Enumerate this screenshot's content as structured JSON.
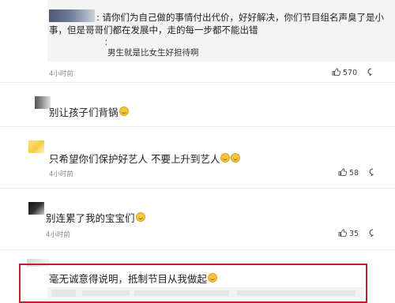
{
  "reply": {
    "line1": ": 请你们为自己做的事情付出代价，好好解决，你们节目组名声臭了是小",
    "line2": "事，但是哥哥们都在发展中，走的每一步都不能出错",
    "line3": "：",
    "line4": "男生就是比女生好担待啊"
  },
  "comments": [
    {
      "id": "c0",
      "time": "4小时前",
      "likes": "570"
    },
    {
      "id": "c1",
      "text": "别让孩子们背锅"
    },
    {
      "id": "c2",
      "text": "只希望你们保护好艺人 不要上升到艺人",
      "time": "4小时前",
      "likes": "58"
    },
    {
      "id": "c3",
      "text": "别连累了我的宝宝们",
      "time": "4小时前",
      "likes": "35"
    },
    {
      "id": "c4",
      "text": "毫无诚意得说明，抵制节目从我做起"
    }
  ],
  "icons": {
    "like": "thumbs-up-icon",
    "reply": "comment-bubble-icon",
    "emoji": "smiley-emoji-icon"
  },
  "colors": {
    "highlight_border": "#b8232a",
    "emoji": "#f5c542",
    "reply_bg": "#f4f4f4"
  }
}
